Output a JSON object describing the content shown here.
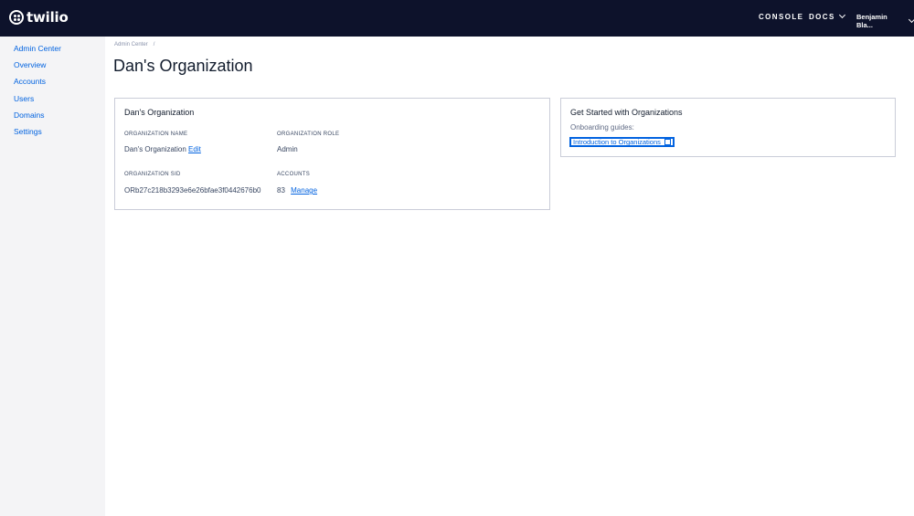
{
  "header": {
    "logo_text": "twilio",
    "nav": {
      "console": "CONSOLE",
      "docs": "DOCS",
      "user": "Benjamin Bla..."
    }
  },
  "sidebar": {
    "items": [
      {
        "label": "Admin Center"
      },
      {
        "label": "Overview"
      },
      {
        "label": "Accounts"
      },
      {
        "label": "Users"
      },
      {
        "label": "Domains"
      },
      {
        "label": "Settings"
      }
    ]
  },
  "breadcrumb": {
    "item": "Admin Center",
    "separator": "/"
  },
  "page": {
    "title": "Dan's Organization"
  },
  "org_card": {
    "title": "Dan's Organization",
    "name_label": "ORGANIZATION NAME",
    "name_value": "Dan's Organization",
    "edit_label": "Edit",
    "role_label": "ORGANIZATION ROLE",
    "role_value": "Admin",
    "sid_label": "ORGANIZATION SID",
    "sid_value": "ORb27c218b3293e6e26bfae3f0442676b0",
    "accounts_label": "ACCOUNTS",
    "accounts_count": "83",
    "manage_label": "Manage"
  },
  "start_card": {
    "title": "Get Started with Organizations",
    "guides_label": "Onboarding guides:",
    "guide_link": "Introduction to Organizations"
  }
}
